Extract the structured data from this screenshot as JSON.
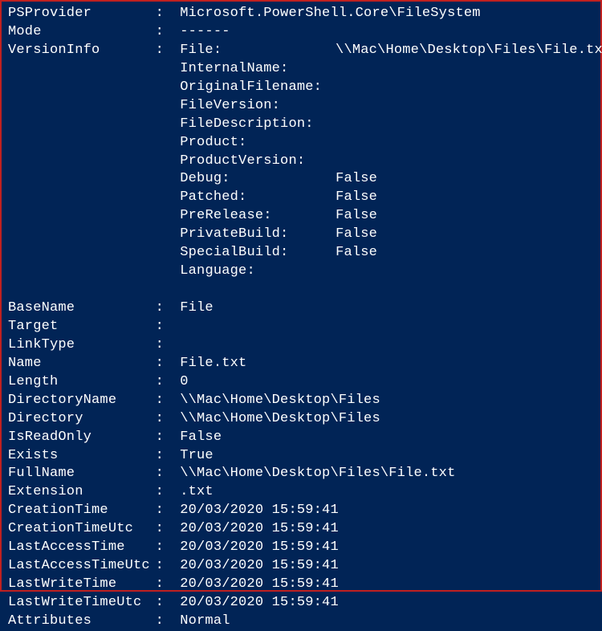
{
  "props": {
    "PSProvider": "Microsoft.PowerShell.Core\\FileSystem",
    "Mode": "------",
    "VersionInfo": {
      "label": "VersionInfo",
      "items": {
        "File": "\\\\Mac\\Home\\Desktop\\Files\\File.txt",
        "InternalName": "",
        "OriginalFilename": "",
        "FileVersion": "",
        "FileDescription": "",
        "Product": "",
        "ProductVersion": "",
        "Debug": "False",
        "Patched": "False",
        "PreRelease": "False",
        "PrivateBuild": "False",
        "SpecialBuild": "False",
        "Language": ""
      }
    },
    "BaseName": "File",
    "Target": "",
    "LinkType": "",
    "Name": "File.txt",
    "Length": "0",
    "DirectoryName": "\\\\Mac\\Home\\Desktop\\Files",
    "Directory": "\\\\Mac\\Home\\Desktop\\Files",
    "IsReadOnly": "False",
    "Exists": "True",
    "FullName": "\\\\Mac\\Home\\Desktop\\Files\\File.txt",
    "Extension": ".txt",
    "CreationTime": "20/03/2020 15:59:41",
    "CreationTimeUtc": "20/03/2020 15:59:41",
    "LastAccessTime": "20/03/2020 15:59:41",
    "LastAccessTimeUtc": "20/03/2020 15:59:41",
    "LastWriteTime": "20/03/2020 15:59:41",
    "LastWriteTimeUtc": "20/03/2020 15:59:41",
    "Attributes": "Normal"
  },
  "labels": {
    "PSProvider": "PSProvider",
    "Mode": "Mode",
    "VersionInfo": "VersionInfo",
    "BaseName": "BaseName",
    "Target": "Target",
    "LinkType": "LinkType",
    "Name": "Name",
    "Length": "Length",
    "DirectoryName": "DirectoryName",
    "Directory": "Directory",
    "IsReadOnly": "IsReadOnly",
    "Exists": "Exists",
    "FullName": "FullName",
    "Extension": "Extension",
    "CreationTime": "CreationTime",
    "CreationTimeUtc": "CreationTimeUtc",
    "LastAccessTime": "LastAccessTime",
    "LastAccessTimeUtc": "LastAccessTimeUtc",
    "LastWriteTime": "LastWriteTime",
    "LastWriteTimeUtc": "LastWriteTimeUtc",
    "Attributes": "Attributes"
  },
  "vilabels": {
    "File": "File:",
    "InternalName": "InternalName:",
    "OriginalFilename": "OriginalFilename:",
    "FileVersion": "FileVersion:",
    "FileDescription": "FileDescription:",
    "Product": "Product:",
    "ProductVersion": "ProductVersion:",
    "Debug": "Debug:",
    "Patched": "Patched:",
    "PreRelease": "PreRelease:",
    "PrivateBuild": "PrivateBuild:",
    "SpecialBuild": "SpecialBuild:",
    "Language": "Language:"
  },
  "colon": ": "
}
